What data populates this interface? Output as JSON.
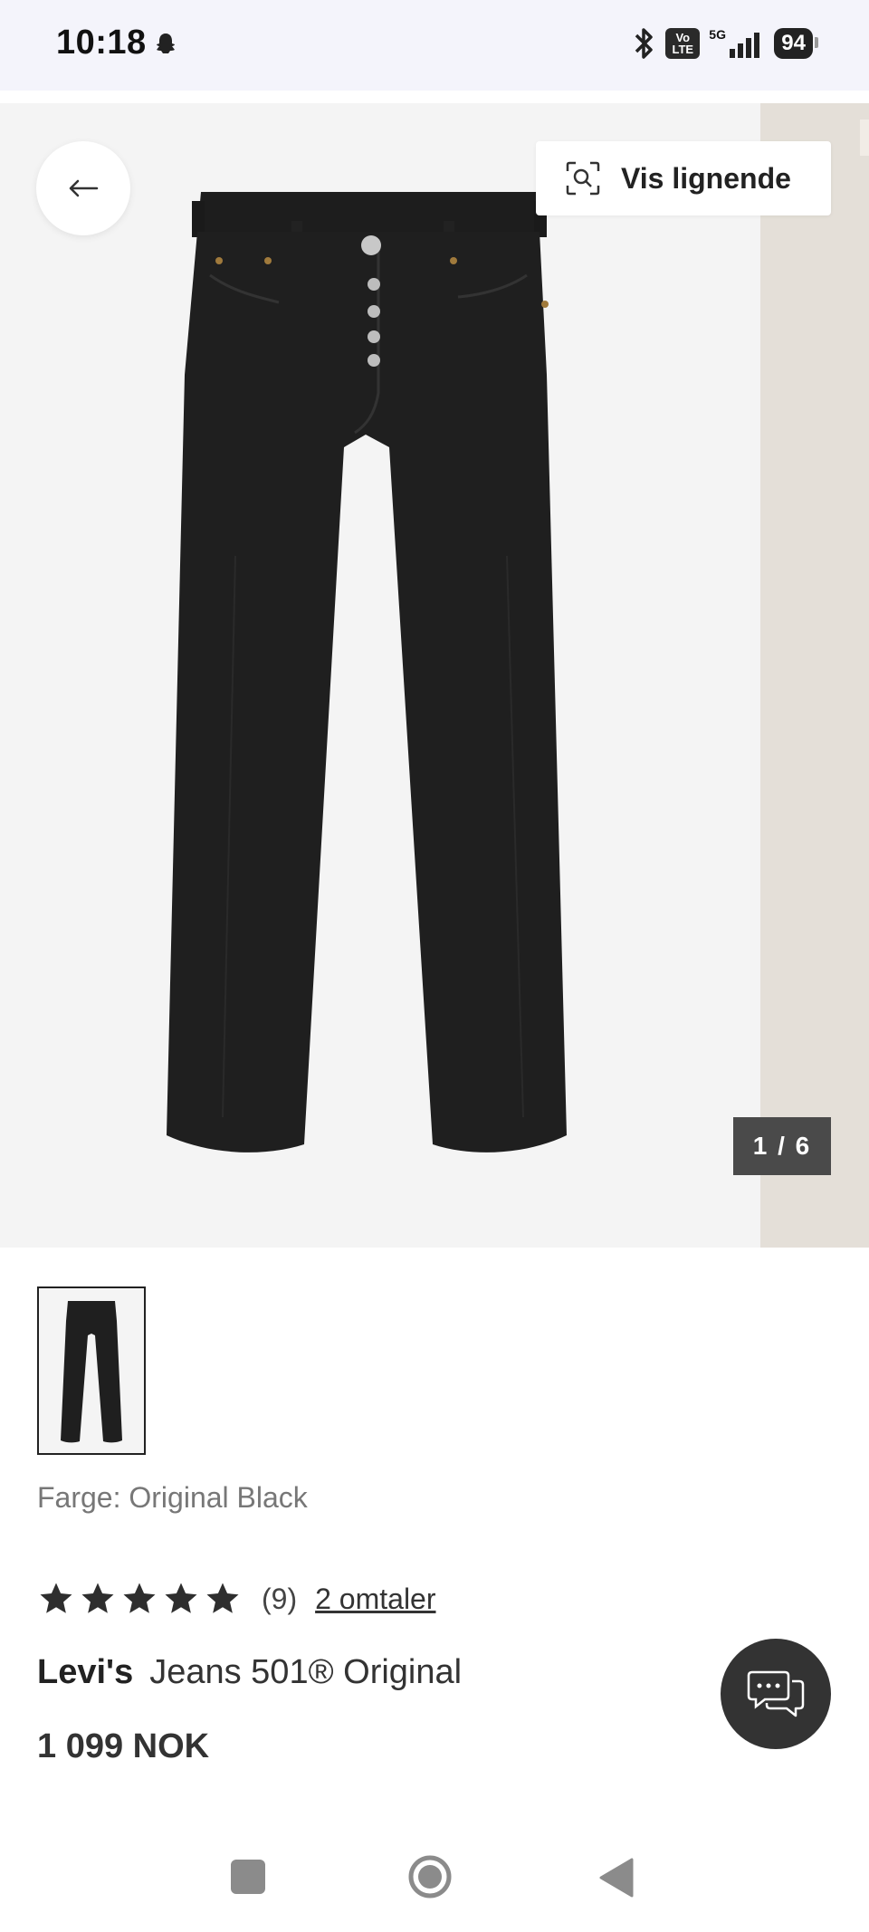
{
  "status_bar": {
    "time": "10:18",
    "network": "5G",
    "volte": "Vo LTE",
    "battery": "94"
  },
  "gallery": {
    "similar_label": "Vis lignende",
    "counter": "1 / 6"
  },
  "product": {
    "color_line": "Farge: Original Black",
    "rating_count": "(9)",
    "reviews_link": "2 omtaler",
    "brand": "Levi's",
    "name": "Jeans 501® Original",
    "price": "1 099 NOK",
    "rating_stars": 5
  },
  "icons": {
    "back": "arrow-left-icon",
    "similar": "visual-search-icon",
    "chat": "chat-bubbles-icon"
  },
  "colors": {
    "jeans": "#1f1f1f",
    "counter_bg": "#4a4a4a",
    "fab_bg": "#333333"
  }
}
